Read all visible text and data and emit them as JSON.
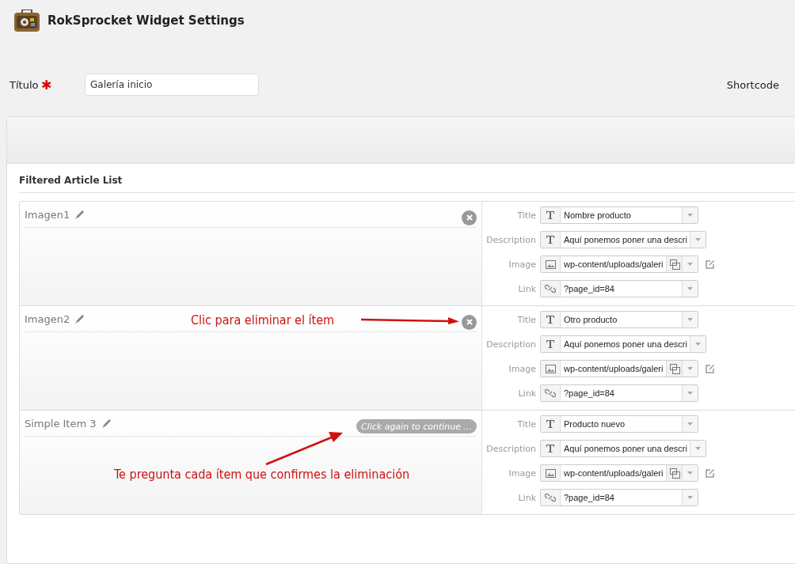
{
  "header": {
    "title": "RokSprocket Widget Settings"
  },
  "title_field": {
    "label": "Título",
    "required_mark": "✱",
    "value": "Galería inicio"
  },
  "shortcode_label": "Shortcode",
  "section": {
    "title": "Filtered Article List"
  },
  "items": [
    {
      "name": "Imagen1",
      "delete": {
        "kind": "button"
      },
      "fields": [
        {
          "kind": "text",
          "label": "Title",
          "value": "Nombre producto"
        },
        {
          "kind": "text",
          "label": "Description",
          "value": "Aquí ponemos poner una descri"
        },
        {
          "kind": "image",
          "label": "Image",
          "value": "wp-content/uploads/galeri"
        },
        {
          "kind": "link",
          "label": "Link",
          "value": "?page_id=84"
        }
      ]
    },
    {
      "name": "Imagen2",
      "delete": {
        "kind": "button"
      },
      "annotation": {
        "kind": "right",
        "text": "Clic para eliminar el ítem"
      },
      "fields": [
        {
          "kind": "text",
          "label": "Title",
          "value": "Otro producto"
        },
        {
          "kind": "text",
          "label": "Description",
          "value": "Aquí ponemos poner una descri"
        },
        {
          "kind": "image",
          "label": "Image",
          "value": "wp-content/uploads/galeri"
        },
        {
          "kind": "link",
          "label": "Link",
          "value": "?page_id=84"
        }
      ]
    },
    {
      "name": "Simple Item 3",
      "delete": {
        "kind": "confirm",
        "label": "Click again to continue ..."
      },
      "annotation": {
        "kind": "up",
        "text": "Te pregunta cada ítem que confirmes la eliminación"
      },
      "fields": [
        {
          "kind": "text",
          "label": "Title",
          "value": "Producto nuevo"
        },
        {
          "kind": "text",
          "label": "Description",
          "value": "Aquí ponemos poner una descri"
        },
        {
          "kind": "image",
          "label": "Image",
          "value": "wp-content/uploads/galeri"
        },
        {
          "kind": "link",
          "label": "Link",
          "value": "?page_id=84"
        }
      ]
    }
  ]
}
